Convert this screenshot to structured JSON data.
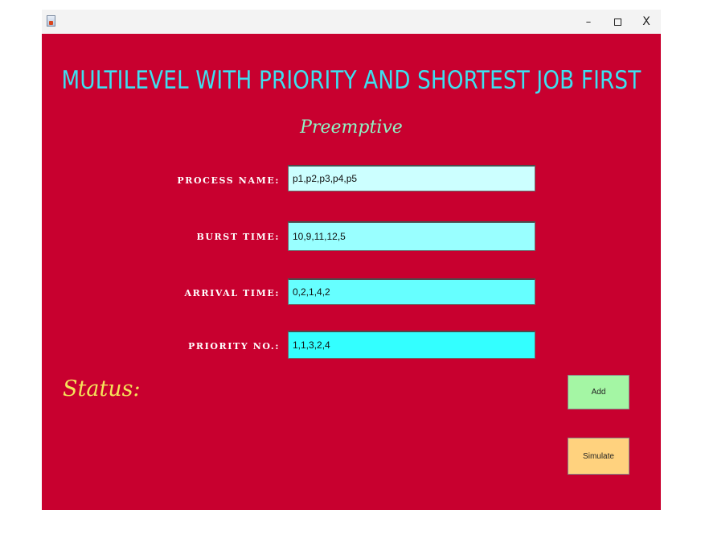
{
  "titlebar": {
    "minimize": "–",
    "close": "X"
  },
  "header": {
    "title": "MULTILEVEL WITH PRIORITY AND SHORTEST JOB FIRST",
    "subtitle": "Preemptive"
  },
  "form": {
    "process_name": {
      "label": "PROCESS NAME:",
      "value": "p1,p2,p3,p4,p5",
      "bg": "#ccffff"
    },
    "burst_time": {
      "label": "BURST TIME:",
      "value": "10,9,11,12,5",
      "bg": "#99ffff"
    },
    "arrival_time": {
      "label": "ARRIVAL TIME:",
      "value": "0,2,1,4,2",
      "bg": "#66ffff"
    },
    "priority_no": {
      "label": "PRIORITY NO.:",
      "value": "1,1,3,2,4",
      "bg": "#33ffff"
    }
  },
  "status": {
    "label": "Status:"
  },
  "buttons": {
    "add": "Add",
    "simulate": "Simulate"
  },
  "colors": {
    "background": "#c8002f",
    "title": "#3de0f0",
    "subtitle": "#8ff2c4",
    "status": "#f4e45a",
    "add_button": "#a4f6a4",
    "simulate_button": "#ffd27e"
  }
}
